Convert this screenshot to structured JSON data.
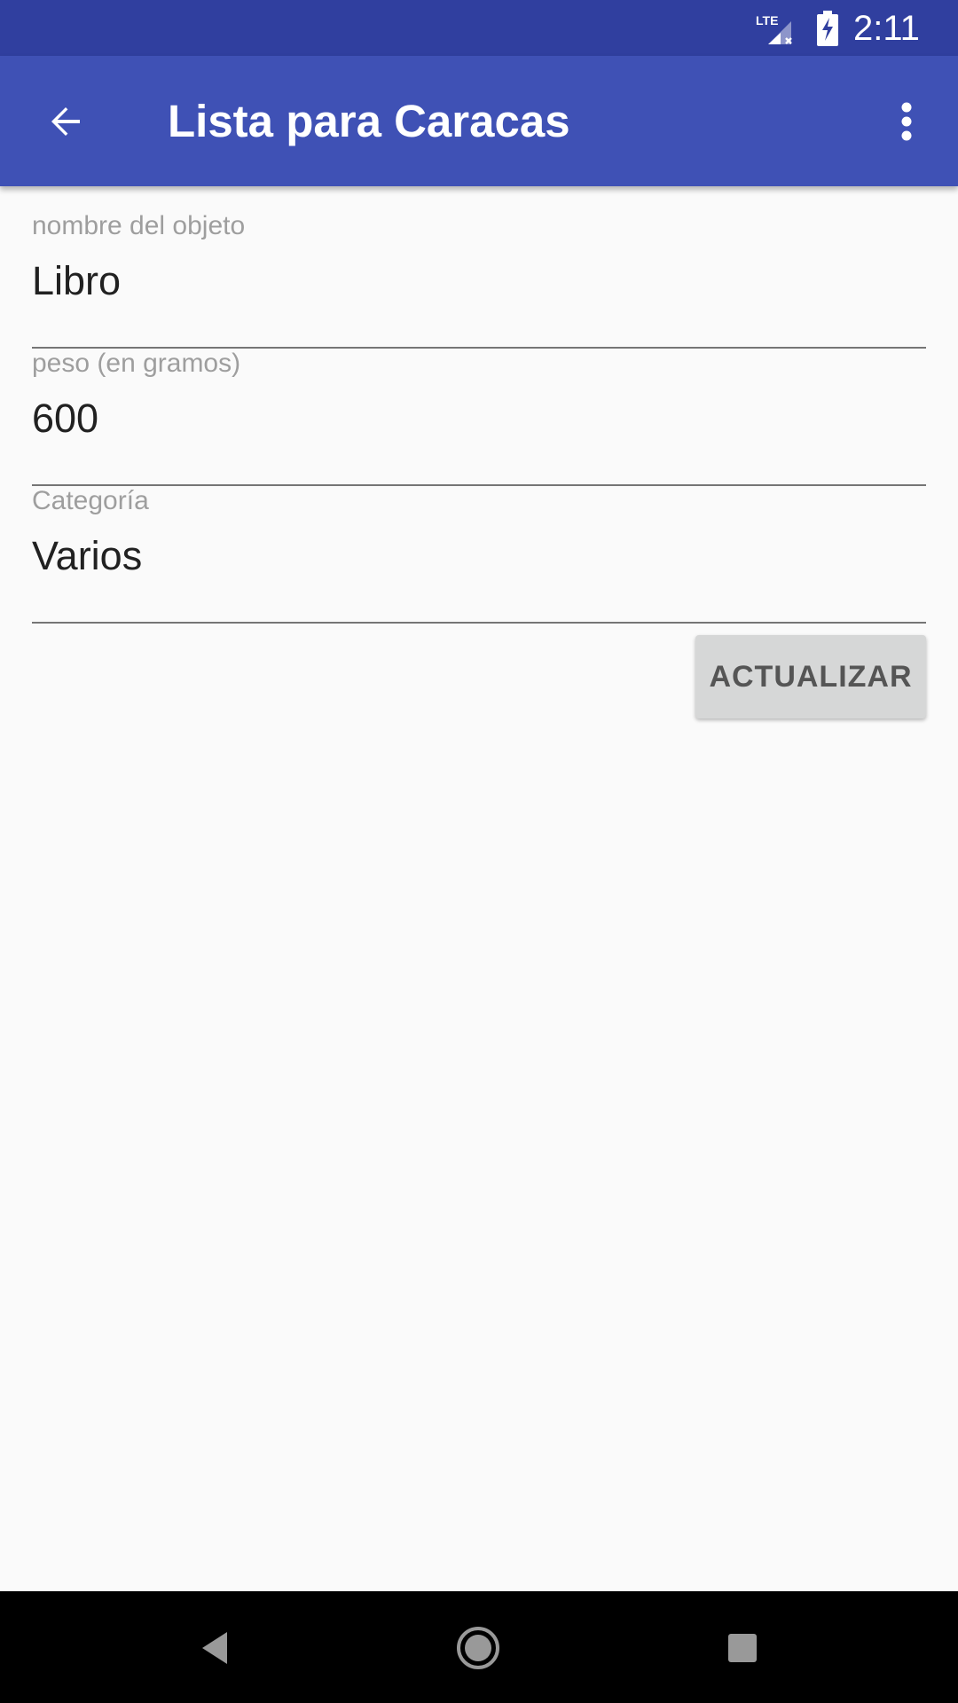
{
  "status_bar": {
    "network_label": "LTE",
    "time": "2:11",
    "icons": [
      "lte-signal-icon",
      "battery-charging-icon"
    ]
  },
  "app_bar": {
    "title": "Lista para Caracas",
    "back_icon": "arrow-back-icon",
    "overflow_icon": "more-vert-icon",
    "background": "#3F51B5",
    "status_background": "#303F9F"
  },
  "form": {
    "fields": [
      {
        "label": "nombre del objeto",
        "value": "Libro"
      },
      {
        "label": "peso (en gramos)",
        "value": "600"
      },
      {
        "label": "Categoría",
        "value": "Varios"
      }
    ],
    "update_button_label": "ACTUALIZAR"
  },
  "nav_bar": {
    "icons": [
      "nav-back-icon",
      "nav-home-icon",
      "nav-recents-icon"
    ]
  }
}
